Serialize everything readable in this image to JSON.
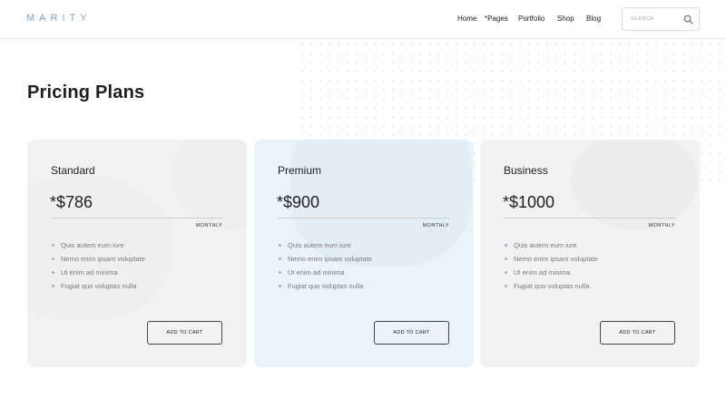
{
  "header": {
    "logo": "MARITY",
    "nav": {
      "home": "Home",
      "pages": "*Pages",
      "portfolio": "Portfolio",
      "shop": "Shop",
      "blog": "Blog"
    },
    "search": {
      "placeholder": "SEARCH"
    }
  },
  "main": {
    "title": "Pricing Plans",
    "plans": [
      {
        "name": "Standard",
        "price": "*$786",
        "period": "MONTHLY",
        "features": [
          "Quis autem eum iure",
          "Nemo enim ipsam voluptate",
          "Ut enim ad minima",
          "Fugiat quo voluptas nulla"
        ],
        "button": "ADD TO CART",
        "background": "#f2f2f2"
      },
      {
        "name": "Premium",
        "price": "*$900",
        "period": "MONTHLY",
        "features": [
          "Quis autem eum iure",
          "Nemo enim ipsam voluptate",
          "Ut enim ad minima",
          "Fugiat quo voluptas nulla"
        ],
        "button": "ADD TO CART",
        "background": "#eaf2fa"
      },
      {
        "name": "Business",
        "price": "*$1000",
        "period": "MONTHLY",
        "features": [
          "Quis autem eum iure",
          "Nemo enim ipsam voluptate",
          "Ut enim ad minima",
          "Fugiat quo voluptas nulla"
        ],
        "button": "ADD TO CART",
        "background": "#f2f2f2"
      }
    ]
  },
  "colors": {
    "logo": "#7fa8c9",
    "bullet": "#9fb3c8",
    "premium_card": "#eaf2fa"
  }
}
